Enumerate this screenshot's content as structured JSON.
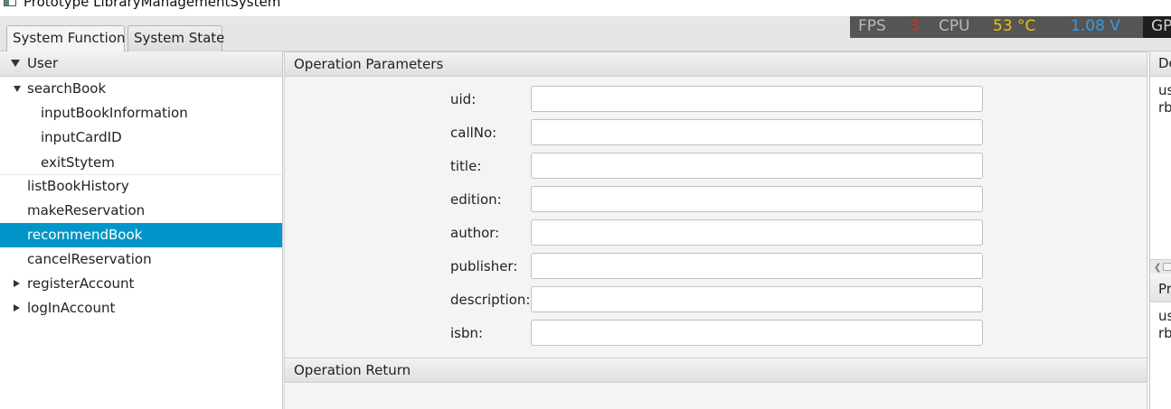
{
  "window": {
    "title": "Prototype LibraryManagementSystem"
  },
  "tabs": [
    {
      "label": "System Function",
      "active": true
    },
    {
      "label": "System State",
      "active": false
    }
  ],
  "perf": {
    "fps_label": "FPS",
    "fps_value": "3",
    "cpu_label": "CPU",
    "cpu_temp": "53 °C",
    "voltage": "1.08 V",
    "gp_label": "GP"
  },
  "tree": {
    "root": "User",
    "items": [
      {
        "label": "searchBook",
        "expander": "expanded"
      },
      {
        "label": "inputBookInformation"
      },
      {
        "label": "inputCardID"
      },
      {
        "label": "exitStytem"
      },
      {
        "label": "listBookHistory"
      },
      {
        "label": "makeReservation"
      },
      {
        "label": "recommendBook",
        "selected": true
      },
      {
        "label": "cancelReservation"
      },
      {
        "label": "registerAccount",
        "expander": "collapsed"
      },
      {
        "label": "logInAccount",
        "expander": "collapsed"
      }
    ]
  },
  "params": {
    "header": "Operation Parameters",
    "fields": [
      {
        "label": "uid:",
        "value": ""
      },
      {
        "label": "callNo:",
        "value": ""
      },
      {
        "label": "title:",
        "value": ""
      },
      {
        "label": "edition:",
        "value": ""
      },
      {
        "label": "author:",
        "value": ""
      },
      {
        "label": "publisher:",
        "value": ""
      },
      {
        "label": "description:",
        "value": ""
      },
      {
        "label": "isbn:",
        "value": ""
      }
    ]
  },
  "return_section": {
    "header": "Operation Return"
  },
  "right_panel": {
    "top_header": "De",
    "top_lines": [
      "us",
      "rb"
    ],
    "bottom_header": "Pr",
    "bottom_lines": [
      "us",
      "rb"
    ]
  },
  "colors": {
    "selection": "#0096c9",
    "fps_value": "#c0392b",
    "cpu_temp": "#e8c20a",
    "voltage": "#3a9be0"
  }
}
